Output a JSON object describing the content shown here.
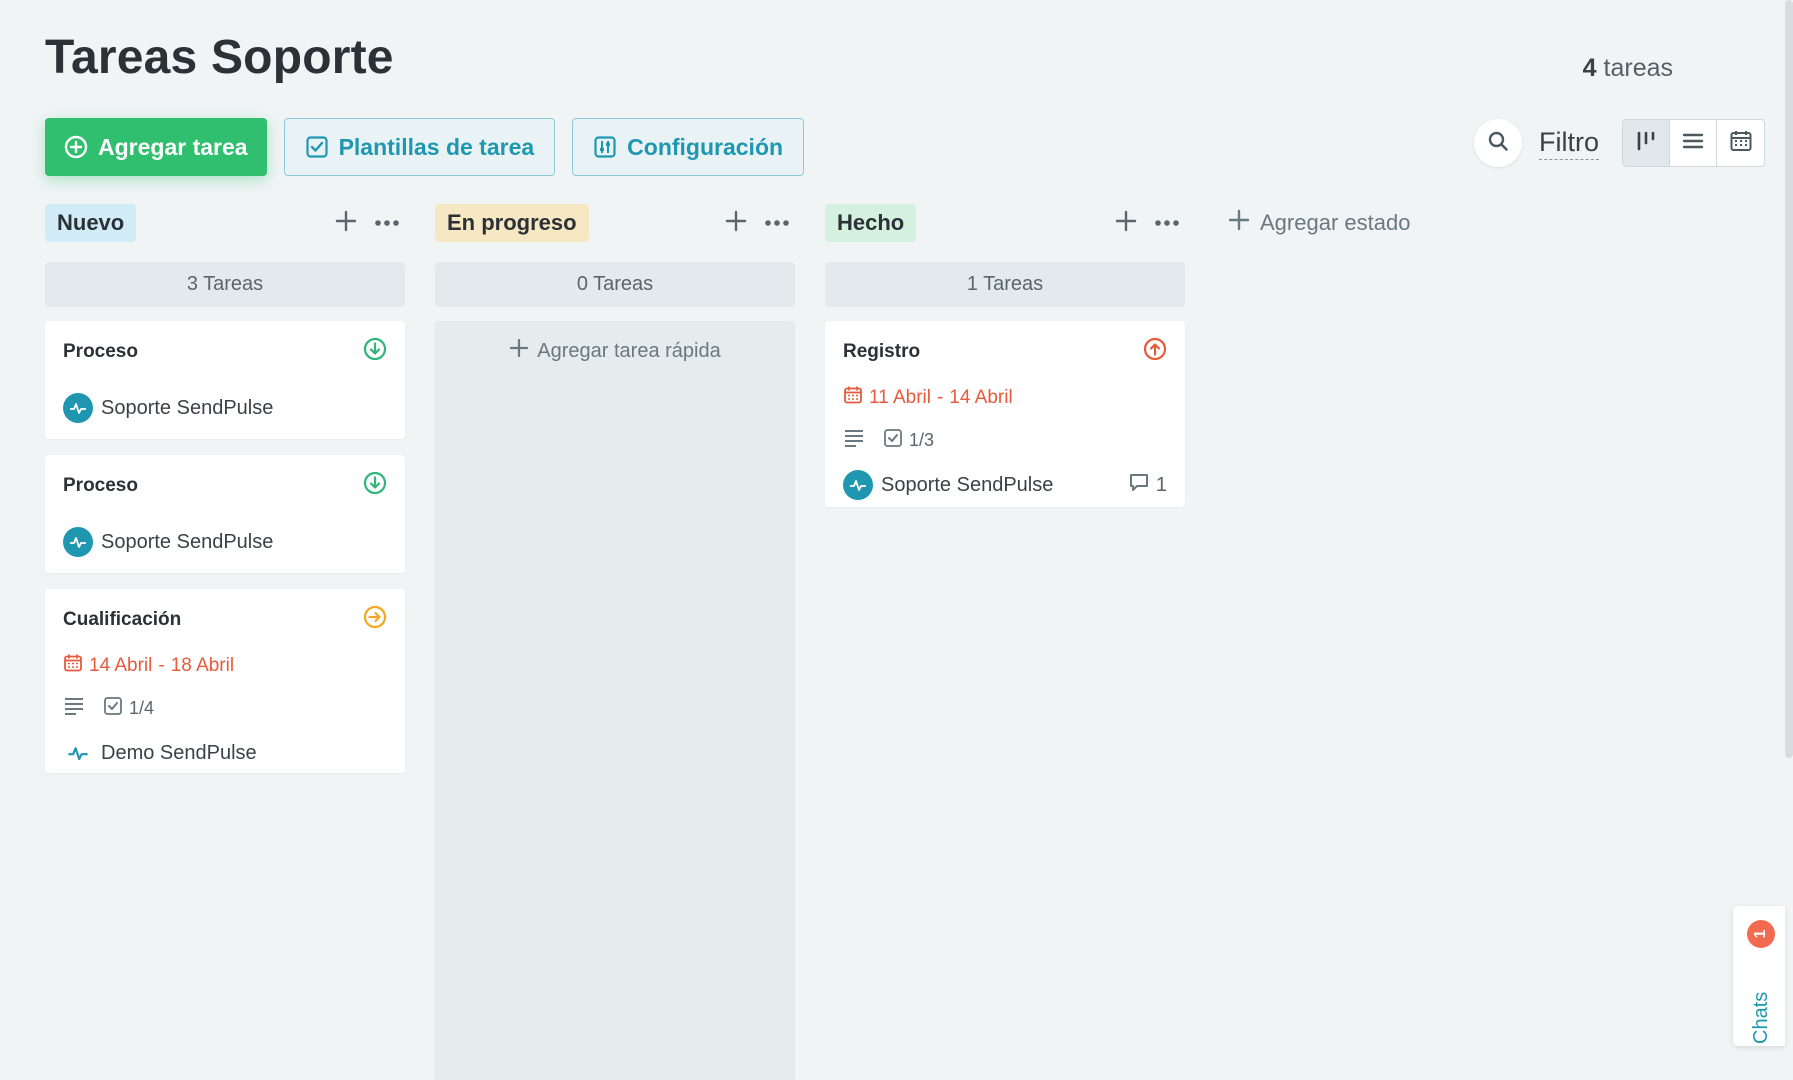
{
  "header": {
    "title": "Tareas Soporte",
    "task_count_number": "4",
    "task_count_label": "tareas"
  },
  "toolbar": {
    "add_task_label": "Agregar tarea",
    "templates_label": "Plantillas de tarea",
    "settings_label": "Configuración",
    "filter_label": "Filtro"
  },
  "columns": [
    {
      "status": "Nuevo",
      "count_label": "3 Tareas",
      "color": "#d2ecf7",
      "cards": [
        {
          "title": "Proceso",
          "priority": "low",
          "owner": "Soporte SendPulse"
        },
        {
          "title": "Proceso",
          "priority": "low",
          "owner": "Soporte SendPulse"
        },
        {
          "title": "Cualificación",
          "priority": "medium",
          "date_start": "14 Abril",
          "date_sep": "-",
          "date_end": "18 Abril",
          "checklist": "1/4",
          "owner": "Demo SendPulse"
        }
      ]
    },
    {
      "status": "En progreso",
      "count_label": "0 Tareas",
      "color": "#f7e8c4",
      "quick_add_label": "Agregar tarea rápida"
    },
    {
      "status": "Hecho",
      "count_label": "1 Tareas",
      "color": "#d3f1de",
      "cards": [
        {
          "title": "Registro",
          "priority": "high",
          "date_start": "11 Abril",
          "date_sep": "-",
          "date_end": "14 Abril",
          "checklist": "1/3",
          "owner": "Soporte SendPulse",
          "comments": "1"
        }
      ]
    }
  ],
  "add_status_label": "Agregar estado",
  "chats": {
    "label": "Chats",
    "badge": "1"
  },
  "colors": {
    "accent": "#1f97b0",
    "primary": "#2fbf6e",
    "priority_low": "#2fb57a",
    "priority_medium": "#f5a623",
    "priority_high": "#e85a3c"
  }
}
